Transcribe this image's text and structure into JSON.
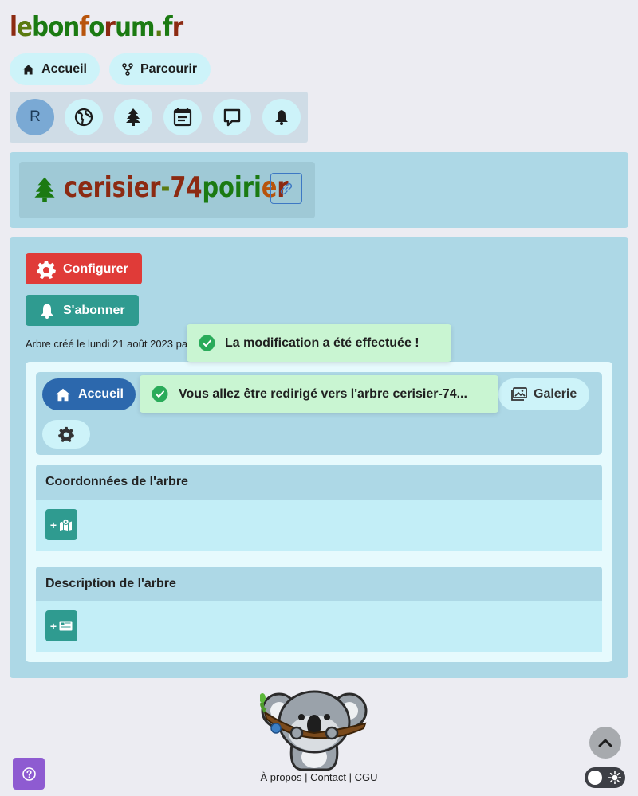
{
  "site": {
    "logo_parts": [
      {
        "text": "l",
        "tone": "c-r"
      },
      {
        "text": "e",
        "tone": "c-d"
      },
      {
        "text": "bon",
        "tone": "c-g"
      },
      {
        "text": "f",
        "tone": "c-o"
      },
      {
        "text": "o",
        "tone": "c-g"
      },
      {
        "text": "r",
        "tone": "c-r"
      },
      {
        "text": "um",
        "tone": "c-g"
      },
      {
        "text": ".",
        "tone": "c-d"
      },
      {
        "text": "f",
        "tone": "c-g"
      },
      {
        "text": "r",
        "tone": "c-r"
      }
    ]
  },
  "nav": {
    "home_label": "Accueil",
    "browse_label": "Parcourir"
  },
  "user": {
    "avatar_initial": "R"
  },
  "tree": {
    "title_parts": [
      {
        "text": "cerisier",
        "tone": "c-r"
      },
      {
        "text": "-",
        "tone": "c-d"
      },
      {
        "text": "74",
        "tone": "c-r"
      },
      {
        "text": "poiri",
        "tone": "c-g"
      },
      {
        "text": "e",
        "tone": "c-o"
      },
      {
        "text": "r",
        "tone": "c-r"
      }
    ],
    "created_text": "Arbre créé le lundi 21 août 2023 pa"
  },
  "actions": {
    "configure_label": "Configurer",
    "subscribe_label": "S'abonner"
  },
  "tabs": {
    "home_label": "Accueil",
    "gallery_label": "Galerie"
  },
  "sections": {
    "coordinates_title": "Coordonnées de l'arbre",
    "description_title": "Description de l'arbre",
    "add_sign": "+"
  },
  "toasts": {
    "success_message": "La modification a été effectuée !",
    "redirect_message": "Vous allez être redirigé vers l'arbre cerisier-74..."
  },
  "footer": {
    "about": "À propos",
    "contact": "Contact",
    "terms": "CGU",
    "separator": "|"
  },
  "colors": {
    "accent_red": "#e03b38",
    "accent_teal": "#2f9b90",
    "accent_blue": "#2c68ad",
    "panel": "#add8e6",
    "toast": "#c9f5d2"
  }
}
